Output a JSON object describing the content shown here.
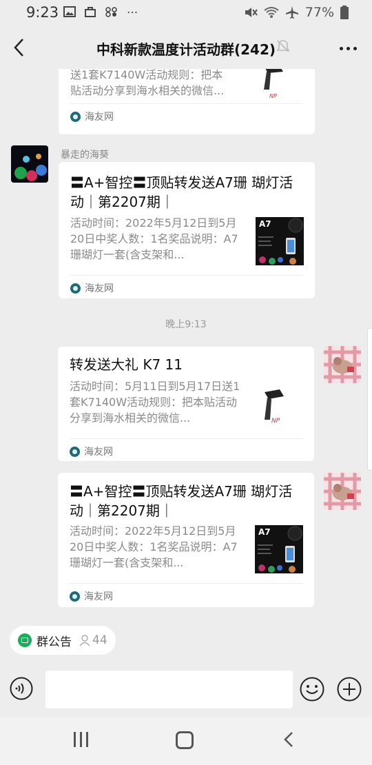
{
  "status_bar": {
    "time": "9:23",
    "battery": "77%"
  },
  "header": {
    "title": "中科新款温度计活动群(242)"
  },
  "messages": {
    "card1": {
      "desc": "送1套K7140W活动规则：把本\n贴活动分享到海水相关的微信...",
      "source": "海友网"
    },
    "sender2": "暴走的海葵",
    "card2": {
      "title": "〓A+智控〓顶贴转发送A7珊 瑚灯活动｜第2207期｜",
      "desc": "活动时间：2022年5月12日到5月20日中奖人数：1名奖品说明：A7珊瑚灯一套(含支架和...",
      "source": "海友网",
      "thumb_label": "A7"
    },
    "timestamp": "晚上9:13",
    "card3": {
      "title": "转发送大礼 K7 11",
      "desc": "活动时间：5月11日到5月17日送1套K7140W活动规则：把本贴活动分享到海水相关的微信...",
      "source": "海友网"
    },
    "card4": {
      "title": "〓A+智控〓顶贴转发送A7珊 瑚灯活动｜第2207期｜",
      "desc": "活动时间：2022年5月12日到5月20日中奖人数：1名奖品说明：A7珊瑚灯一套(含支架和...",
      "source": "海友网",
      "thumb_label": "A7"
    }
  },
  "bottom": {
    "notice_label": "群公告",
    "member_count": "44"
  },
  "colors": {
    "background": "#ededed",
    "accent": "#1aad5a"
  }
}
